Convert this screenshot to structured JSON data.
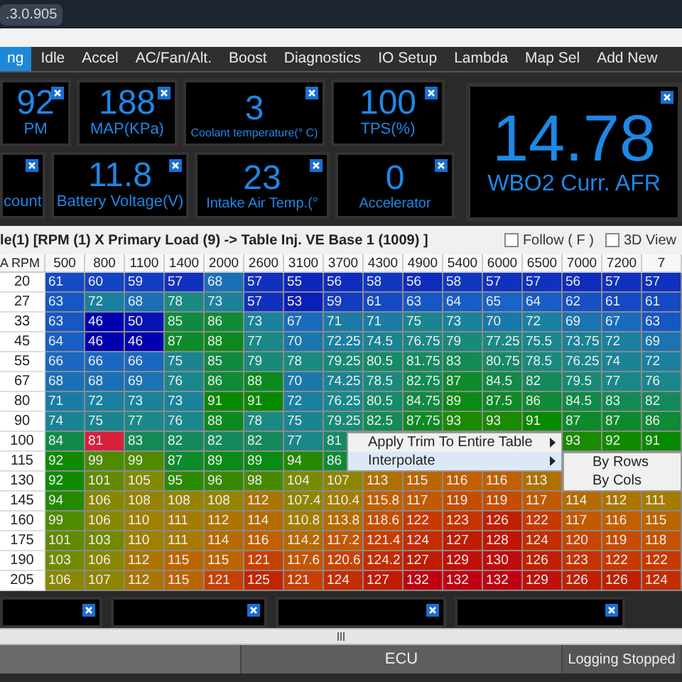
{
  "window": {
    "title": ".3.0.905"
  },
  "tabs": [
    {
      "label": "ng",
      "selected": true
    },
    {
      "label": "Idle",
      "selected": false
    },
    {
      "label": "Accel",
      "selected": false
    },
    {
      "label": "AC/Fan/Alt.",
      "selected": false
    },
    {
      "label": "Boost",
      "selected": false
    },
    {
      "label": "Diagnostics",
      "selected": false
    },
    {
      "label": "IO Setup",
      "selected": false
    },
    {
      "label": "Lambda",
      "selected": false
    },
    {
      "label": "Map Sel",
      "selected": false
    },
    {
      "label": "Add New",
      "selected": false
    }
  ],
  "gauge_rows": [
    [
      {
        "value": "92",
        "label": "PM"
      },
      {
        "value": "188",
        "label": "MAP(KPa)"
      },
      {
        "value": "3",
        "label": "Coolant temperature(° C)"
      },
      {
        "value": "100",
        "label": "TPS(%)"
      }
    ],
    [
      {
        "label": "count"
      },
      {
        "value": "11.8",
        "label": "Battery Voltage(V)"
      },
      {
        "value": "23",
        "label": "Intake Air Temp.(°"
      },
      {
        "value": "0",
        "label": "Accelerator"
      }
    ]
  ],
  "big_gauge": {
    "value": "14.78",
    "label": "WBO2 Curr. AFR"
  },
  "breadcrumb": "le(1) [RPM (1)  X Primary Load (9)  -> Table Inj. VE Base 1 (1009) ]",
  "checkboxes": [
    {
      "label": "Follow ( F )",
      "checked": false
    },
    {
      "label": "3D View",
      "checked": false
    }
  ],
  "table": {
    "corner": "A RPM",
    "columns": [
      "500",
      "800",
      "1100",
      "1400",
      "2000",
      "2600",
      "3100",
      "3700",
      "4300",
      "4900",
      "5400",
      "6000",
      "6500",
      "7000",
      "7200",
      "7"
    ],
    "rows": [
      {
        "label": "20",
        "cells": [
          "61",
          "60",
          "59",
          "57",
          "68",
          "57",
          "55",
          "56",
          "58",
          "56",
          "58",
          "57",
          "57",
          "56",
          "57",
          "57"
        ]
      },
      {
        "label": "27",
        "cells": [
          "63",
          "72",
          "68",
          "78",
          "73",
          "57",
          "53",
          "59",
          "61",
          "63",
          "64",
          "65",
          "64",
          "62",
          "61",
          "61"
        ]
      },
      {
        "label": "33",
        "cells": [
          "63",
          "46",
          "50",
          "85",
          "86",
          "73",
          "67",
          "71",
          "71",
          "75",
          "73",
          "70",
          "72",
          "69",
          "67",
          "63"
        ]
      },
      {
        "label": "45",
        "cells": [
          "64",
          "46",
          "46",
          "87",
          "88",
          "77",
          "70",
          "72.25",
          "74.5",
          "76.75",
          "79",
          "77.25",
          "75.5",
          "73.75",
          "72",
          "69"
        ]
      },
      {
        "label": "55",
        "cells": [
          "66",
          "66",
          "66",
          "75",
          "85",
          "79",
          "78",
          "79.25",
          "80.5",
          "81.75",
          "83",
          "80.75",
          "78.5",
          "76.25",
          "74",
          "72"
        ]
      },
      {
        "label": "67",
        "cells": [
          "68",
          "68",
          "69",
          "76",
          "86",
          "88",
          "70",
          "74.25",
          "78.5",
          "82.75",
          "87",
          "84.5",
          "82",
          "79.5",
          "77",
          "76"
        ]
      },
      {
        "label": "80",
        "cells": [
          "71",
          "72",
          "73",
          "73",
          "91",
          "91",
          "72",
          "76.25",
          "80.5",
          "84.75",
          "89",
          "87.5",
          "86",
          "84.5",
          "83",
          "82"
        ]
      },
      {
        "label": "90",
        "cells": [
          "74",
          "75",
          "77",
          "76",
          "88",
          "78",
          "75",
          "79.25",
          "82.5",
          "87.75",
          "93",
          "93",
          "91",
          "87",
          "87",
          "86"
        ]
      },
      {
        "label": "100",
        "cells": [
          "84",
          {
            "value": "81",
            "selected": true
          },
          "83",
          "82",
          "82",
          "82",
          "77",
          "81",
          null,
          null,
          null,
          null,
          null,
          "93",
          "92",
          "91"
        ]
      },
      {
        "label": "115",
        "cells": [
          "92",
          "99",
          "99",
          "87",
          "89",
          "89",
          "94",
          "86",
          null,
          null,
          null,
          null,
          null,
          null,
          null,
          null
        ]
      },
      {
        "label": "130",
        "cells": [
          "92",
          "101",
          "105",
          "95",
          "96",
          "98",
          "104",
          "107",
          "113",
          "115",
          "116",
          "116",
          "113",
          null,
          null,
          null
        ]
      },
      {
        "label": "145",
        "cells": [
          "94",
          "106",
          "108",
          "108",
          "108",
          "112",
          "107.4",
          "110.4",
          "115.8",
          "117",
          "119",
          "119",
          "117",
          "114",
          "112",
          "111"
        ]
      },
      {
        "label": "160",
        "cells": [
          "99",
          "106",
          "110",
          "111",
          "112",
          "114",
          "110.8",
          "113.8",
          "118.6",
          "122",
          "123",
          "126",
          "122",
          "117",
          "116",
          "115"
        ]
      },
      {
        "label": "175",
        "cells": [
          "101",
          "103",
          "110",
          "111",
          "114",
          "116",
          "114.2",
          "117.2",
          "121.4",
          "124",
          "127",
          "128",
          "124",
          "120",
          "119",
          "118"
        ]
      },
      {
        "label": "190",
        "cells": [
          "103",
          "106",
          "112",
          "115",
          "115",
          "121",
          "117.6",
          "120.6",
          "124.2",
          "127",
          "129",
          "130",
          "126",
          "123",
          "122",
          "122"
        ]
      },
      {
        "label": "205",
        "cells": [
          "106",
          "107",
          "112",
          "115",
          "121",
          "125",
          "121",
          "124",
          "127",
          "132",
          "132",
          "132",
          "129",
          "126",
          "126",
          "124"
        ]
      }
    ]
  },
  "context_menu": {
    "items": [
      {
        "label": "Apply Trim To Entire Table",
        "selected": false,
        "submenu": true
      },
      {
        "label": "Interpolate",
        "selected": true,
        "submenu": true
      }
    ]
  },
  "submenu": {
    "items": [
      {
        "label": "By Rows",
        "selected": false
      },
      {
        "label": "By Cols",
        "selected": false
      }
    ]
  },
  "status_bar": [
    "ECU",
    "Logging Stopped"
  ]
}
